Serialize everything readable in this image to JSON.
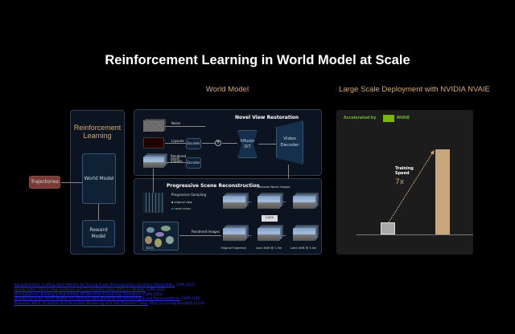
{
  "title": "Reinforcement Learning in World Model at Scale",
  "world_model_heading": "World Model",
  "deployment_heading": "Large Scale Deployment with NVIDIA NVAIE",
  "rl": {
    "title": "Reinforcement Learning",
    "world_model": "World Model",
    "reward_model": "Reward Model",
    "trajectories": "Trajectories"
  },
  "nvr": {
    "title": "Novel View Restoration",
    "noise": "Noise",
    "layouts": "Layouts",
    "rendered": "Rendered novel images",
    "encoder": "Encoder",
    "plus": "+",
    "dit": "Diffusion DiT",
    "decoder": "Video Decoder"
  },
  "psr": {
    "title": "Progressive Scene Reconstruction",
    "sampling": "Progressive Sampling",
    "original_view": "original view",
    "novel_views": "novel views",
    "gs": "3DGS",
    "rendered_images": "Rendered Images",
    "restored": "Restored Novel Images",
    "loss": "Loss",
    "dots": "...",
    "captions": [
      "Original Trajectory",
      "Lane Shift @ 1.5m",
      "Lane Shift @ 3.0m"
    ]
  },
  "deploy": {
    "accelerated_by": "Accelerated by",
    "nvaie": "NVAIE",
    "speed_label": "Training Speed",
    "speedup": "7x",
    "bars": [
      1,
      7
    ],
    "bar_colors": [
      "#a8a8a8",
      "#c8a57a"
    ],
    "brand_green": "#76b900"
  },
  "references": [
    {
      "text": "ReconDreamer: Crafting World Models for Driving Scene Reconstruction via Online Restoration,",
      "venue": " CVPR 2025"
    },
    {
      "text": "StreetCrafter: Street View Synthesis with Controllable Video Diffusion Models,",
      "venue": " CVPR 2025"
    },
    {
      "text": "DrivingSphere: Building a High-fidelity 4D World for Closed-loop Simulation,",
      "venue": " CVPR 2025"
    },
    {
      "text": "DriveDreamer4D: World Models Are Effective Data Machines for 4D Driving Scene Representation,",
      "venue": " CVPR 2025"
    },
    {
      "text": "Gaussian 3DGS: Distortion and Secondary Rendering with Fast Distorted Tiling,",
      "venue": " https://arxiv.org/abs/2412.12129"
    }
  ]
}
